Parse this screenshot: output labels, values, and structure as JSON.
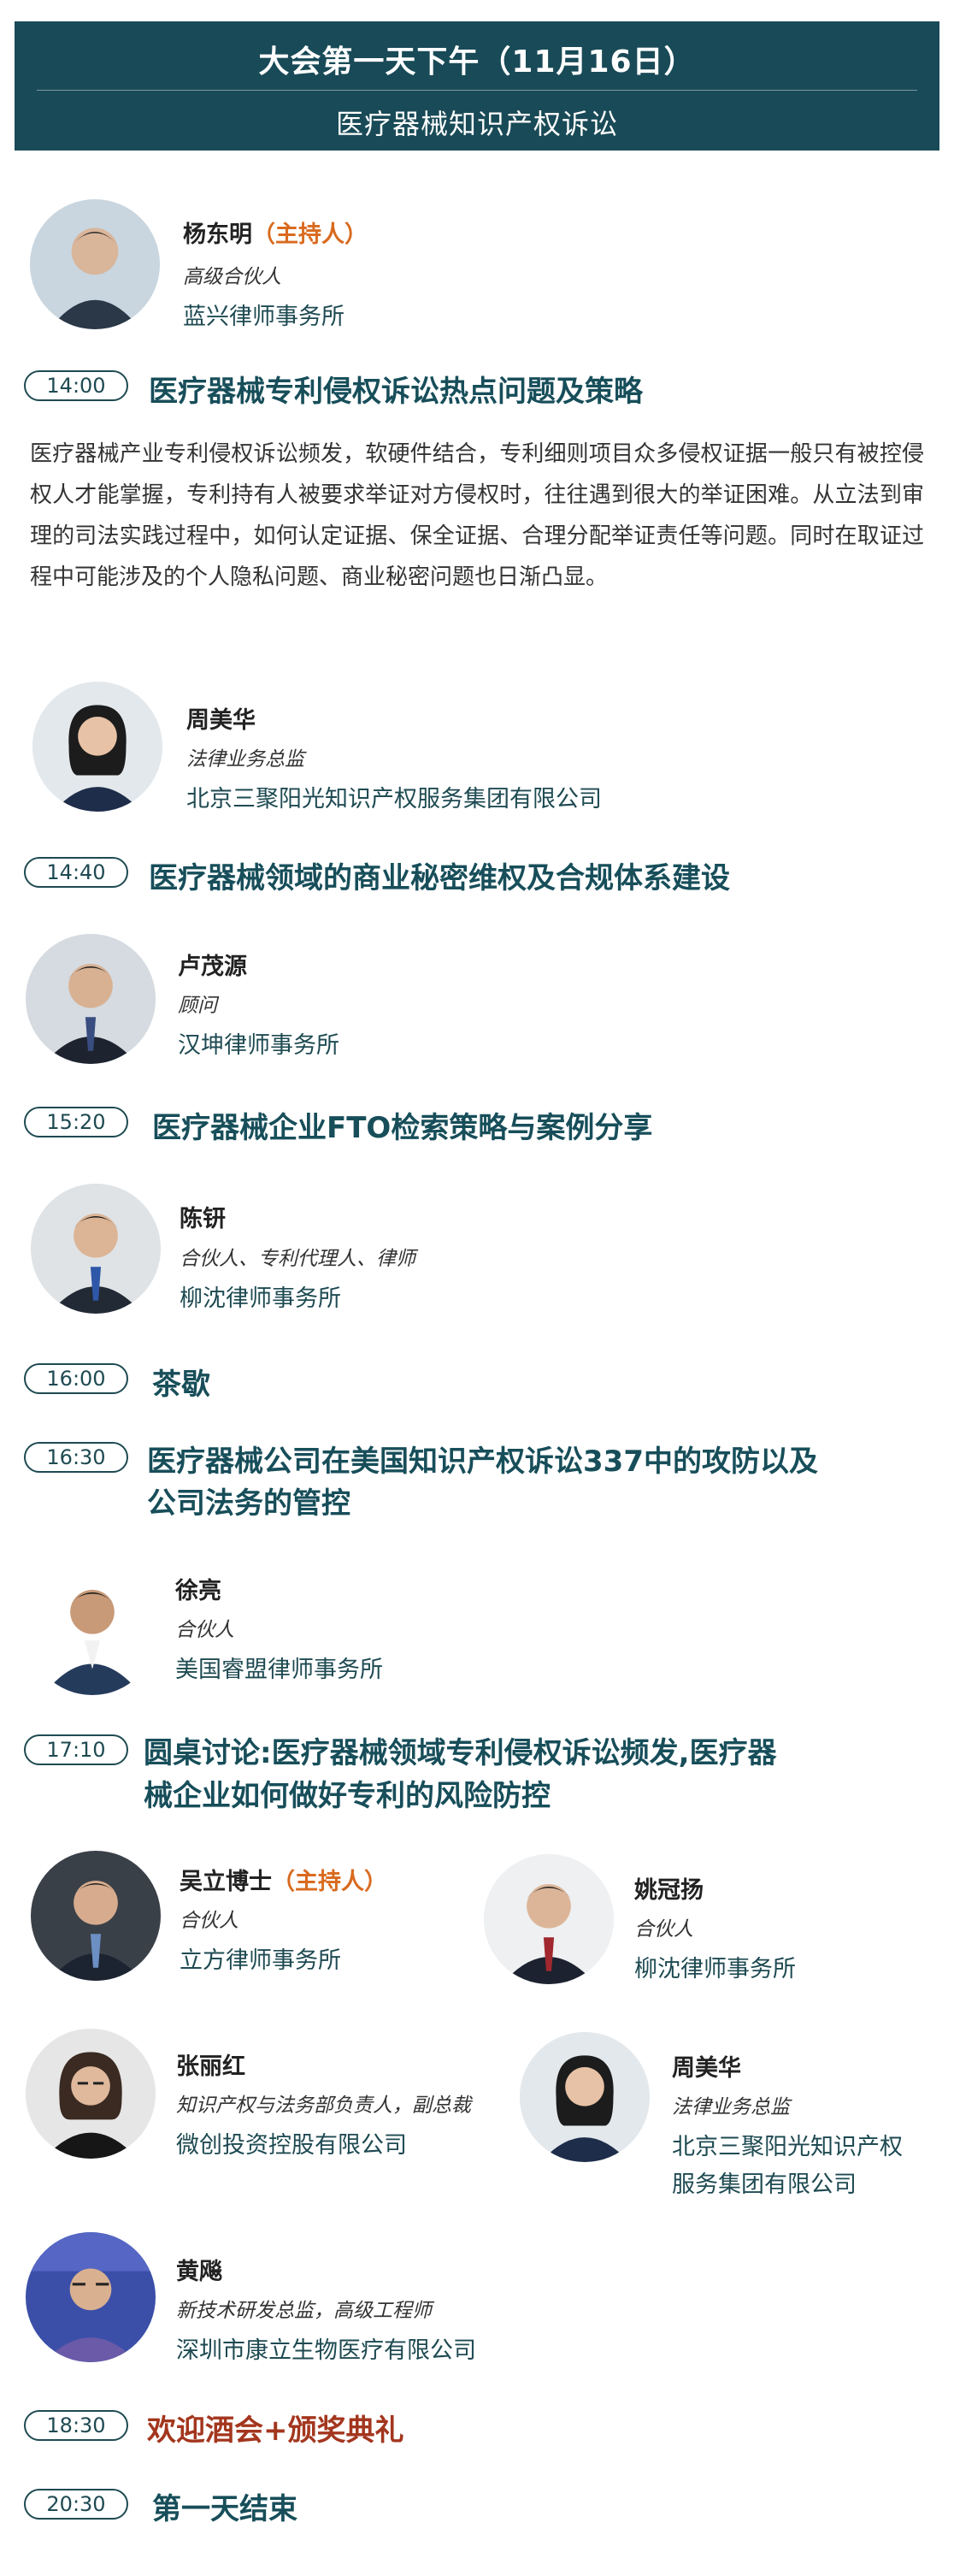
{
  "header": {
    "title": "大会第一天下午（11月16日）",
    "subtitle": "医疗器械知识产权诉讼"
  },
  "host": {
    "name": "杨东明",
    "role_tag": "（主持人）",
    "title": "高级合伙人",
    "org": "蓝兴律师事务所"
  },
  "sessions": [
    {
      "time": "14:00",
      "topic": "医疗器械专利侵权诉讼热点问题及策略"
    },
    {
      "time": "14:40",
      "topic": "医疗器械领域的商业秘密维权及合规体系建设"
    },
    {
      "time": "15:20",
      "topic": "医疗器械企业FTO检索策略与案例分享"
    },
    {
      "time": "16:00",
      "topic": "茶歇"
    },
    {
      "time": "16:30",
      "topic_line1": "医疗器械公司在美国知识产权诉讼337中的攻防以及",
      "topic_line2": "公司法务的管控"
    },
    {
      "time": "17:10",
      "topic_line1": "圆桌讨论:医疗器械领域专利侵权诉讼频发,医疗器",
      "topic_line2": "械企业如何做好专利的风险防控"
    },
    {
      "time": "18:30",
      "topic": "欢迎酒会+颁奖典礼"
    },
    {
      "time": "20:30",
      "topic": "第一天结束"
    }
  ],
  "description": "医疗器械产业专利侵权诉讼频发，软硬件结合，专利细则项目众多侵权证据一般只有被控侵权人才能掌握，专利持有人被要求举证对方侵权时，往往遇到很大的举证困难。从立法到审理的司法实践过程中，如何认定证据、保全证据、合理分配举证责任等问题。同时在取证过程中可能涉及的个人隐私问题、商业秘密问题也日渐凸显。",
  "speakers": {
    "s1": {
      "name": "周美华",
      "title": "法律业务总监",
      "org": "北京三聚阳光知识产权服务集团有限公司"
    },
    "s2": {
      "name": "卢茂源",
      "title": "顾问",
      "org": "汉坤律师事务所"
    },
    "s3": {
      "name": "陈钘",
      "title": "合伙人、专利代理人、律师",
      "org": "柳沈律师事务所"
    },
    "s4": {
      "name": "徐亮",
      "title": "合伙人",
      "org": "美国睿盟律师事务所"
    }
  },
  "panel": {
    "p1": {
      "name": "吴立博士",
      "role_tag": "（主持人）",
      "title": "合伙人",
      "org": "立方律师事务所"
    },
    "p2": {
      "name": "姚冠扬",
      "title": "合伙人",
      "org": "柳沈律师事务所"
    },
    "p3": {
      "name": "张丽红",
      "title": "知识产权与法务部负责人，副总裁",
      "org": "微创投资控股有限公司"
    },
    "p4": {
      "name": "周美华",
      "title": "法律业务总监",
      "org_line1": "北京三聚阳光知识产权",
      "org_line2": "服务集团有限公司"
    },
    "p5": {
      "name": "黄飚",
      "title": "新技术研发总监，高级工程师",
      "org": "深圳市康立生物医疗有限公司"
    }
  },
  "colors": {
    "header_bg": "#194a57",
    "accent_orange": "#d96a1f",
    "teal_text": "#174e5a",
    "red_text": "#a3361e"
  }
}
